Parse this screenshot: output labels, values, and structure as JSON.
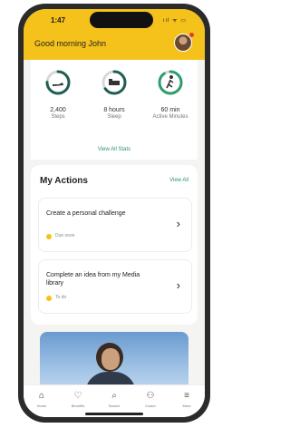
{
  "status": {
    "time": "1:47",
    "icons": "ııl ᯤ ▭"
  },
  "header": {
    "greeting": "Good morning John",
    "accent": "#f5c21b"
  },
  "stats": [
    {
      "value": "2,400",
      "unit": "Steps",
      "progress": 0.75,
      "color": "#1f5f53",
      "icon": "shoe-icon"
    },
    {
      "value": "8 hours",
      "unit": "Sleep",
      "progress": 0.65,
      "color": "#1f5f53",
      "icon": "bed-icon"
    },
    {
      "value": "60 min",
      "unit": "Active Minutes",
      "progress": 0.9,
      "color": "#2e9d6d",
      "icon": "walk-icon"
    }
  ],
  "view_stats_label": "View All Stats",
  "actions": {
    "title": "My Actions",
    "view_all": "View All",
    "items": [
      {
        "title": "Create a personal challenge",
        "meta": "Due soon"
      },
      {
        "title": "Complete an idea from my Media library",
        "meta": "To do"
      }
    ]
  },
  "tabs": [
    {
      "label": "Home",
      "icon": "home-icon",
      "glyph": "⌂"
    },
    {
      "label": "Benefits",
      "icon": "heart-icon",
      "glyph": "♡"
    },
    {
      "label": "Search",
      "icon": "search-icon",
      "glyph": "⌕"
    },
    {
      "label": "Coach",
      "icon": "person-icon",
      "glyph": "⚇"
    },
    {
      "label": "More",
      "icon": "menu-icon",
      "glyph": "≡"
    }
  ]
}
